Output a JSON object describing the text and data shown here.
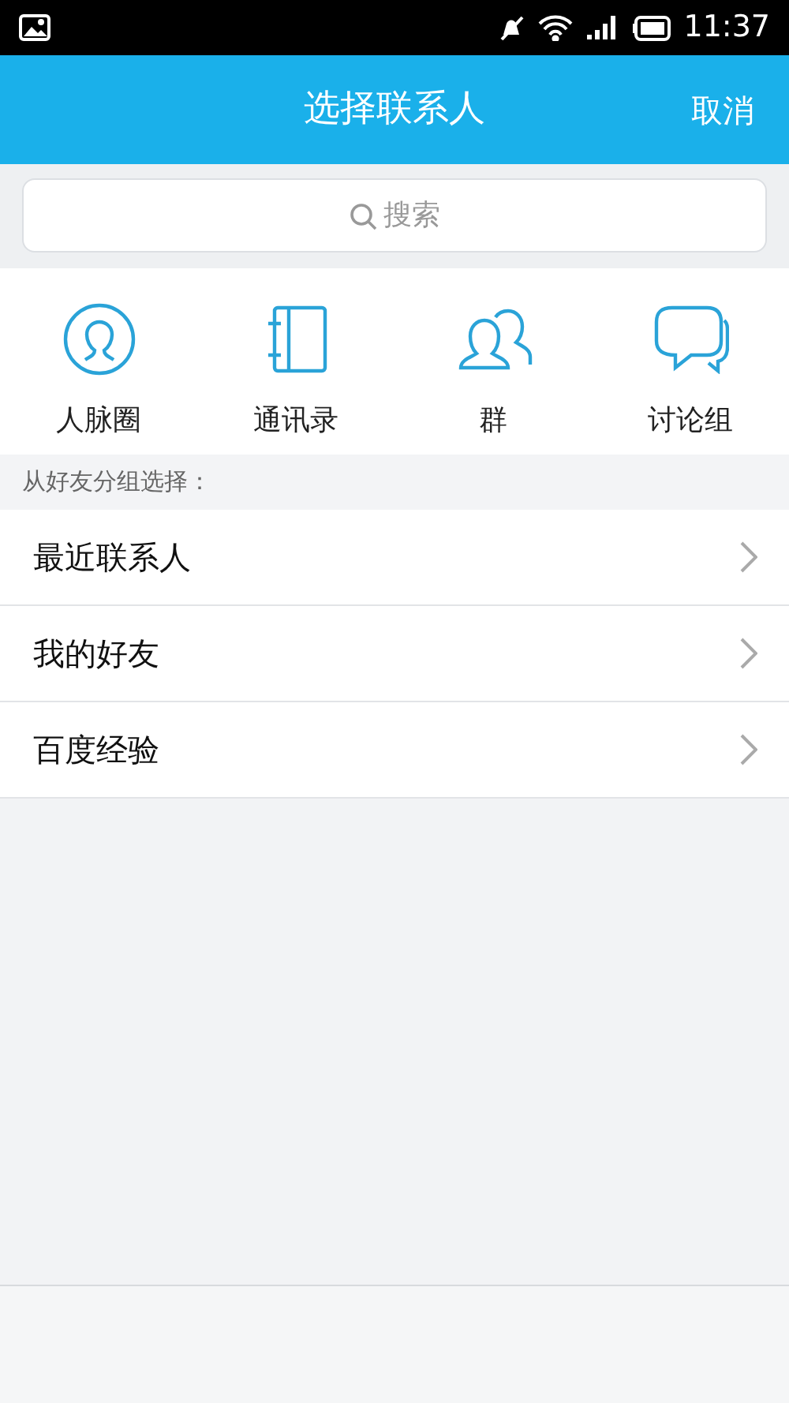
{
  "status_bar": {
    "time": "11:37"
  },
  "header": {
    "title": "选择联系人",
    "cancel": "取消"
  },
  "search": {
    "placeholder": "搜索"
  },
  "shortcuts": [
    {
      "label": "人脉圈",
      "kind": "circle"
    },
    {
      "label": "通讯录",
      "kind": "book"
    },
    {
      "label": "群",
      "kind": "group"
    },
    {
      "label": "讨论组",
      "kind": "chat"
    }
  ],
  "section_label": "从好友分组选择：",
  "groups": [
    {
      "label": "最近联系人"
    },
    {
      "label": "我的好友"
    },
    {
      "label": "百度经验"
    }
  ]
}
